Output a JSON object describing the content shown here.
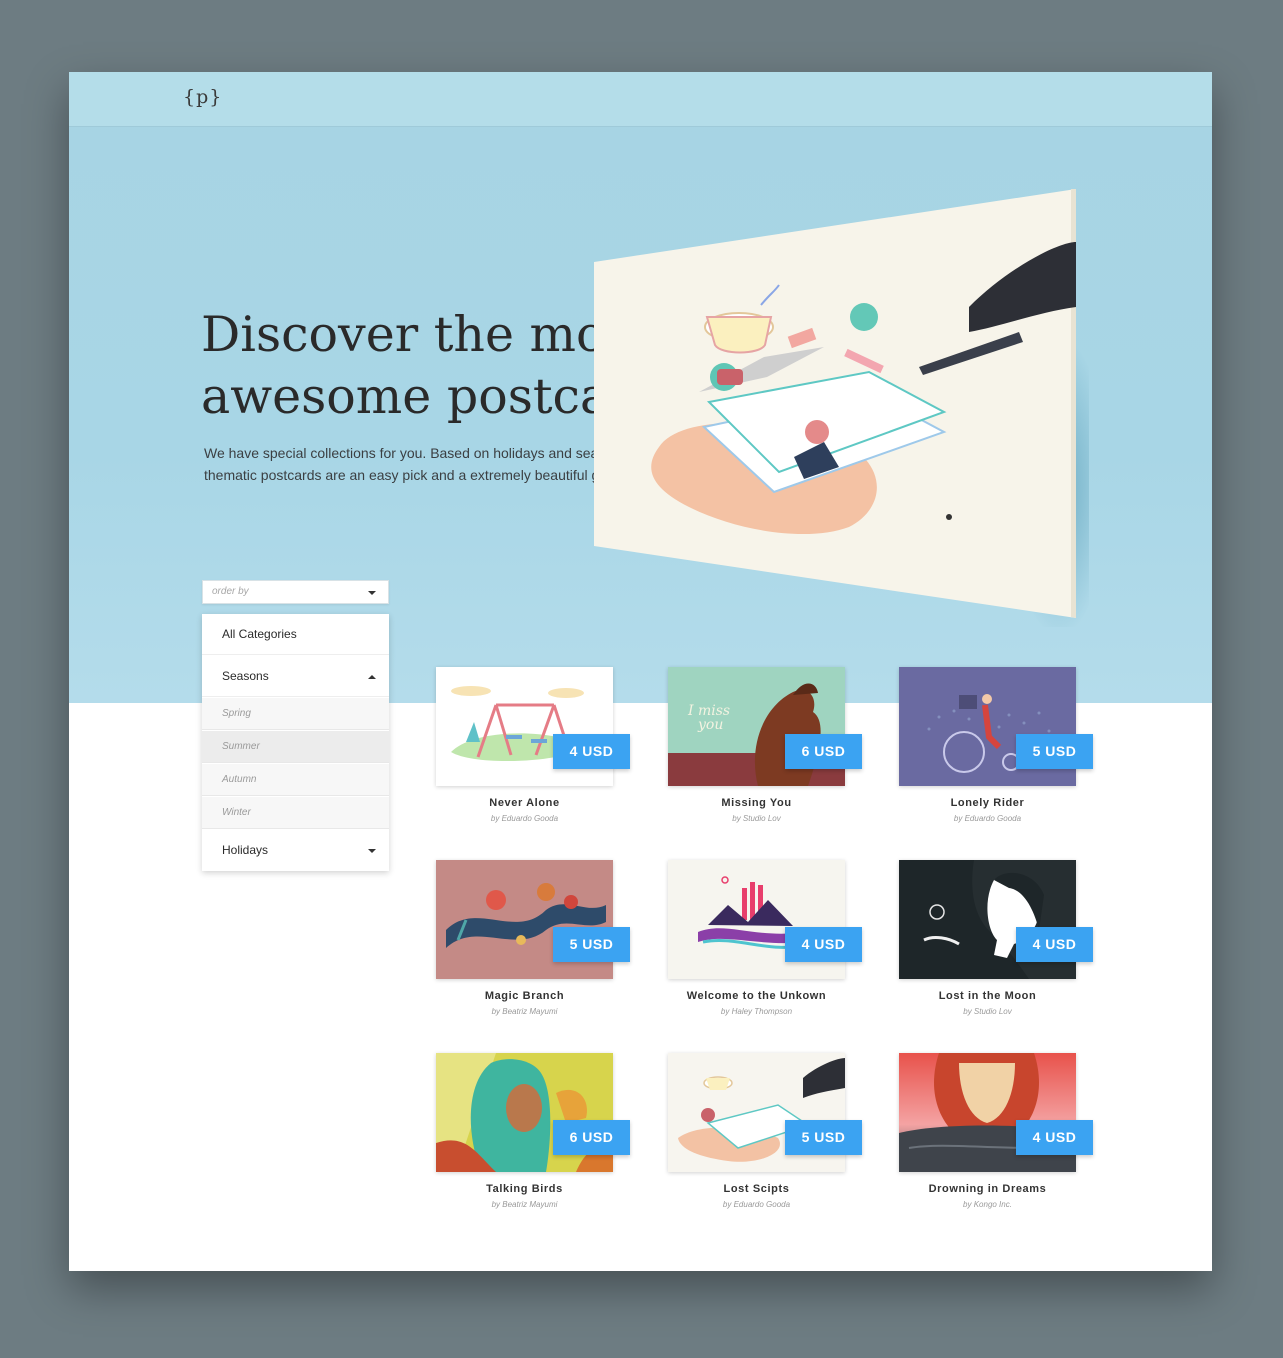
{
  "header": {
    "logo": "{p}"
  },
  "hero": {
    "headline": "Discover the most awesome postcards",
    "description": "We have special collections for you. Based on holidays and seasons, our thematic postcards are an easy pick and a extremely beautiful go with gifts."
  },
  "filters": {
    "order_placeholder": "order by",
    "categories": {
      "all": "All Categories",
      "seasons": "Seasons",
      "seasons_items": [
        "Spring",
        "Summer",
        "Autumn",
        "Winter"
      ],
      "holidays": "Holidays"
    }
  },
  "products": [
    {
      "title": "Never Alone",
      "author": "by Eduardo Gooda",
      "price": "4 USD"
    },
    {
      "title": "Missing You",
      "author": "by Studio Lov",
      "price": "6 USD"
    },
    {
      "title": "Lonely Rider",
      "author": "by Eduardo Gooda",
      "price": "5 USD"
    },
    {
      "title": "Magic Branch",
      "author": "by Beatriz Mayumi",
      "price": "5 USD"
    },
    {
      "title": "Welcome to the Unkown",
      "author": "by Haley Thompson",
      "price": "4 USD"
    },
    {
      "title": "Lost in the Moon",
      "author": "by Studio Lov",
      "price": "4 USD"
    },
    {
      "title": "Talking Birds",
      "author": "by Beatriz Mayumi",
      "price": "6 USD"
    },
    {
      "title": "Lost Scipts",
      "author": "by Eduardo Gooda",
      "price": "5 USD"
    },
    {
      "title": "Drowning in Dreams",
      "author": "by Kongo Inc.",
      "price": "4 USD"
    }
  ],
  "colors": {
    "accent": "#3ba3f2",
    "hero_bg": "#a8d6e6",
    "page_bg": "#6d7c82"
  }
}
